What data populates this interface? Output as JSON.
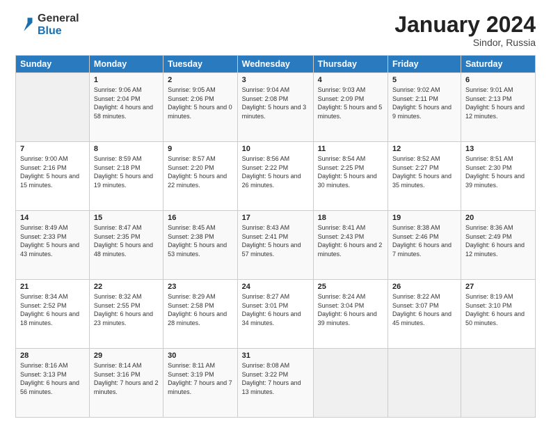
{
  "logo": {
    "general": "General",
    "blue": "Blue"
  },
  "header": {
    "month": "January 2024",
    "location": "Sindor, Russia"
  },
  "days_of_week": [
    "Sunday",
    "Monday",
    "Tuesday",
    "Wednesday",
    "Thursday",
    "Friday",
    "Saturday"
  ],
  "weeks": [
    [
      {
        "day": "",
        "sunrise": "",
        "sunset": "",
        "daylight": ""
      },
      {
        "day": "1",
        "sunrise": "Sunrise: 9:06 AM",
        "sunset": "Sunset: 2:04 PM",
        "daylight": "Daylight: 4 hours and 58 minutes."
      },
      {
        "day": "2",
        "sunrise": "Sunrise: 9:05 AM",
        "sunset": "Sunset: 2:06 PM",
        "daylight": "Daylight: 5 hours and 0 minutes."
      },
      {
        "day": "3",
        "sunrise": "Sunrise: 9:04 AM",
        "sunset": "Sunset: 2:08 PM",
        "daylight": "Daylight: 5 hours and 3 minutes."
      },
      {
        "day": "4",
        "sunrise": "Sunrise: 9:03 AM",
        "sunset": "Sunset: 2:09 PM",
        "daylight": "Daylight: 5 hours and 5 minutes."
      },
      {
        "day": "5",
        "sunrise": "Sunrise: 9:02 AM",
        "sunset": "Sunset: 2:11 PM",
        "daylight": "Daylight: 5 hours and 9 minutes."
      },
      {
        "day": "6",
        "sunrise": "Sunrise: 9:01 AM",
        "sunset": "Sunset: 2:13 PM",
        "daylight": "Daylight: 5 hours and 12 minutes."
      }
    ],
    [
      {
        "day": "7",
        "sunrise": "Sunrise: 9:00 AM",
        "sunset": "Sunset: 2:16 PM",
        "daylight": "Daylight: 5 hours and 15 minutes."
      },
      {
        "day": "8",
        "sunrise": "Sunrise: 8:59 AM",
        "sunset": "Sunset: 2:18 PM",
        "daylight": "Daylight: 5 hours and 19 minutes."
      },
      {
        "day": "9",
        "sunrise": "Sunrise: 8:57 AM",
        "sunset": "Sunset: 2:20 PM",
        "daylight": "Daylight: 5 hours and 22 minutes."
      },
      {
        "day": "10",
        "sunrise": "Sunrise: 8:56 AM",
        "sunset": "Sunset: 2:22 PM",
        "daylight": "Daylight: 5 hours and 26 minutes."
      },
      {
        "day": "11",
        "sunrise": "Sunrise: 8:54 AM",
        "sunset": "Sunset: 2:25 PM",
        "daylight": "Daylight: 5 hours and 30 minutes."
      },
      {
        "day": "12",
        "sunrise": "Sunrise: 8:52 AM",
        "sunset": "Sunset: 2:27 PM",
        "daylight": "Daylight: 5 hours and 35 minutes."
      },
      {
        "day": "13",
        "sunrise": "Sunrise: 8:51 AM",
        "sunset": "Sunset: 2:30 PM",
        "daylight": "Daylight: 5 hours and 39 minutes."
      }
    ],
    [
      {
        "day": "14",
        "sunrise": "Sunrise: 8:49 AM",
        "sunset": "Sunset: 2:33 PM",
        "daylight": "Daylight: 5 hours and 43 minutes."
      },
      {
        "day": "15",
        "sunrise": "Sunrise: 8:47 AM",
        "sunset": "Sunset: 2:35 PM",
        "daylight": "Daylight: 5 hours and 48 minutes."
      },
      {
        "day": "16",
        "sunrise": "Sunrise: 8:45 AM",
        "sunset": "Sunset: 2:38 PM",
        "daylight": "Daylight: 5 hours and 53 minutes."
      },
      {
        "day": "17",
        "sunrise": "Sunrise: 8:43 AM",
        "sunset": "Sunset: 2:41 PM",
        "daylight": "Daylight: 5 hours and 57 minutes."
      },
      {
        "day": "18",
        "sunrise": "Sunrise: 8:41 AM",
        "sunset": "Sunset: 2:43 PM",
        "daylight": "Daylight: 6 hours and 2 minutes."
      },
      {
        "day": "19",
        "sunrise": "Sunrise: 8:38 AM",
        "sunset": "Sunset: 2:46 PM",
        "daylight": "Daylight: 6 hours and 7 minutes."
      },
      {
        "day": "20",
        "sunrise": "Sunrise: 8:36 AM",
        "sunset": "Sunset: 2:49 PM",
        "daylight": "Daylight: 6 hours and 12 minutes."
      }
    ],
    [
      {
        "day": "21",
        "sunrise": "Sunrise: 8:34 AM",
        "sunset": "Sunset: 2:52 PM",
        "daylight": "Daylight: 6 hours and 18 minutes."
      },
      {
        "day": "22",
        "sunrise": "Sunrise: 8:32 AM",
        "sunset": "Sunset: 2:55 PM",
        "daylight": "Daylight: 6 hours and 23 minutes."
      },
      {
        "day": "23",
        "sunrise": "Sunrise: 8:29 AM",
        "sunset": "Sunset: 2:58 PM",
        "daylight": "Daylight: 6 hours and 28 minutes."
      },
      {
        "day": "24",
        "sunrise": "Sunrise: 8:27 AM",
        "sunset": "Sunset: 3:01 PM",
        "daylight": "Daylight: 6 hours and 34 minutes."
      },
      {
        "day": "25",
        "sunrise": "Sunrise: 8:24 AM",
        "sunset": "Sunset: 3:04 PM",
        "daylight": "Daylight: 6 hours and 39 minutes."
      },
      {
        "day": "26",
        "sunrise": "Sunrise: 8:22 AM",
        "sunset": "Sunset: 3:07 PM",
        "daylight": "Daylight: 6 hours and 45 minutes."
      },
      {
        "day": "27",
        "sunrise": "Sunrise: 8:19 AM",
        "sunset": "Sunset: 3:10 PM",
        "daylight": "Daylight: 6 hours and 50 minutes."
      }
    ],
    [
      {
        "day": "28",
        "sunrise": "Sunrise: 8:16 AM",
        "sunset": "Sunset: 3:13 PM",
        "daylight": "Daylight: 6 hours and 56 minutes."
      },
      {
        "day": "29",
        "sunrise": "Sunrise: 8:14 AM",
        "sunset": "Sunset: 3:16 PM",
        "daylight": "Daylight: 7 hours and 2 minutes."
      },
      {
        "day": "30",
        "sunrise": "Sunrise: 8:11 AM",
        "sunset": "Sunset: 3:19 PM",
        "daylight": "Daylight: 7 hours and 7 minutes."
      },
      {
        "day": "31",
        "sunrise": "Sunrise: 8:08 AM",
        "sunset": "Sunset: 3:22 PM",
        "daylight": "Daylight: 7 hours and 13 minutes."
      },
      {
        "day": "",
        "sunrise": "",
        "sunset": "",
        "daylight": ""
      },
      {
        "day": "",
        "sunrise": "",
        "sunset": "",
        "daylight": ""
      },
      {
        "day": "",
        "sunrise": "",
        "sunset": "",
        "daylight": ""
      }
    ]
  ]
}
